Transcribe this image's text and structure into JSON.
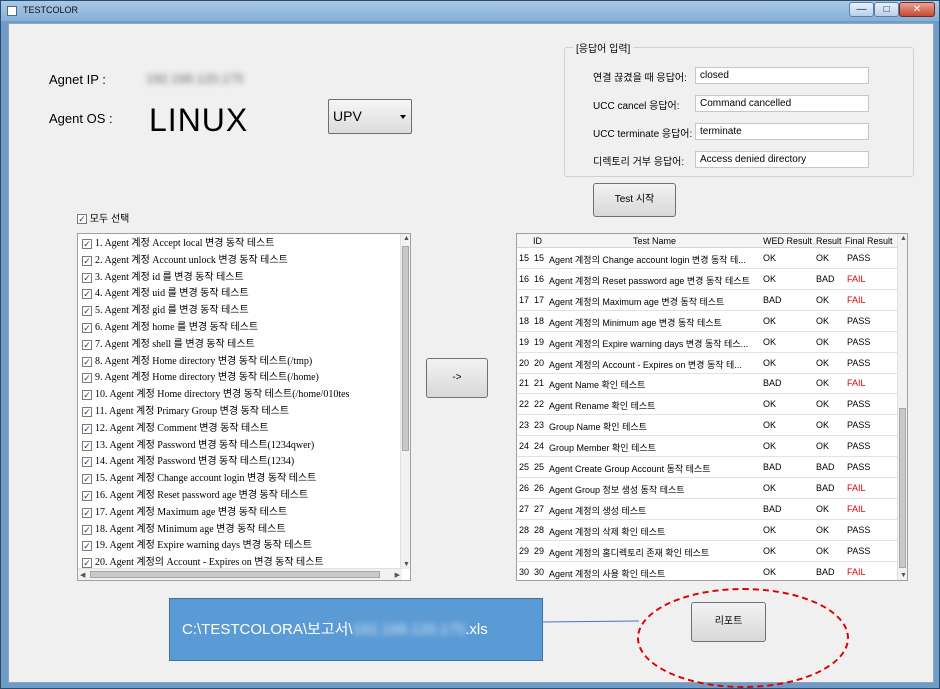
{
  "window": {
    "title": "TESTCOLOR",
    "min_glyph": "—",
    "max_glyph": "□",
    "close_glyph": "✕"
  },
  "agent": {
    "ip_label": "Agnet IP :",
    "ip_value": "192.168.120.175",
    "os_label": "Agent OS :",
    "os_value": "LINUX",
    "type_combo": "UPV"
  },
  "responses": {
    "legend": "[응답어 입력]",
    "rows": [
      {
        "label": "연결 끊겼을 때 응답어:",
        "value": "closed"
      },
      {
        "label": "UCC cancel 응답어:",
        "value": "Command cancelled"
      },
      {
        "label": "UCC terminate 응답어:",
        "value": "terminate"
      },
      {
        "label": "디렉토리 거부 응답어:",
        "value": "Access denied directory"
      }
    ]
  },
  "test_start_label": "Test 시작",
  "select_all_label": "모두 선택",
  "select_all_checked": true,
  "test_list": [
    "1. Agent 계정 Accept local 변경 동작 테스트",
    "2. Agent 계정 Account unlock 변경 동작 테스트",
    "3. Agent 계정 id 를 변경 동작 테스트",
    "4. Agent 계정 uid 를 변경 동작 테스트",
    "5. Agent 계정 gid 를 변경 동작 테스트",
    "6. Agent 계정 home 를 변경 동작 테스트",
    "7. Agent 계정 shell 를 변경 동작 테스트",
    "8. Agent 계정 Home directory 변경 동작 테스트(/tmp)",
    "9. Agent 계정 Home directory 변경 동작 테스트(/home)",
    "10. Agent 계정 Home directory 변경 동작 테스트(/home/010tes",
    "11. Agent 계정 Primary Group 변경 동작 테스트",
    "12. Agent 계정 Comment 변경 동작 테스트",
    "13. Agent 계정 Password 변경 동작 테스트(1234qwer)",
    "14. Agent 계정 Password 변경 동작 테스트(1234)",
    "15. Agent 계정 Change account login 변경 동작 테스트",
    "16. Agent 계정 Reset password age 변경 동작 테스트",
    "17. Agent 계정 Maximum age 변경 동작 테스트",
    "18. Agent 계정 Minimum age 변경 동작 테스트",
    "19. Agent 계정 Expire warning days 변경 동작 테스트",
    "20. Agent 계정의 Account - Expires on 변경 동작 테스트"
  ],
  "move_button_label": "->",
  "results": {
    "headers": [
      "ID",
      "Test Name",
      "WED Result",
      "Result",
      "Final Result"
    ],
    "rows": [
      {
        "n": "15",
        "id": "15",
        "name": "Agent 계정의 Change account login 변경 동작 테...",
        "wed": "OK",
        "result": "OK",
        "final": "PASS"
      },
      {
        "n": "16",
        "id": "16",
        "name": "Agent 계정의 Reset password age 변경 동작 테스트",
        "wed": "OK",
        "result": "BAD",
        "final": "FAIL"
      },
      {
        "n": "17",
        "id": "17",
        "name": "Agent 계정의 Maximum age 변경 동작 테스트",
        "wed": "BAD",
        "result": "OK",
        "final": "FAIL"
      },
      {
        "n": "18",
        "id": "18",
        "name": "Agent 계정의 Minimum age 변경 동작 테스트",
        "wed": "OK",
        "result": "OK",
        "final": "PASS"
      },
      {
        "n": "19",
        "id": "19",
        "name": "Agent 계정의 Expire warning days 변경 동작 테스...",
        "wed": "OK",
        "result": "OK",
        "final": "PASS"
      },
      {
        "n": "20",
        "id": "20",
        "name": "Agent 계정의 Account - Expires on 변경 동작 테...",
        "wed": "OK",
        "result": "OK",
        "final": "PASS"
      },
      {
        "n": "21",
        "id": "21",
        "name": "Agent Name 확인 테스트",
        "wed": "BAD",
        "result": "OK",
        "final": "FAIL"
      },
      {
        "n": "22",
        "id": "22",
        "name": "Agent Rename 확인 테스트",
        "wed": "OK",
        "result": "OK",
        "final": "PASS"
      },
      {
        "n": "23",
        "id": "23",
        "name": "Group Name 확인 테스트",
        "wed": "OK",
        "result": "OK",
        "final": "PASS"
      },
      {
        "n": "24",
        "id": "24",
        "name": "Group Member 확인 테스트",
        "wed": "OK",
        "result": "OK",
        "final": "PASS"
      },
      {
        "n": "25",
        "id": "25",
        "name": "Agent Create Group Account 동작 테스트",
        "wed": "BAD",
        "result": "BAD",
        "final": "PASS"
      },
      {
        "n": "26",
        "id": "26",
        "name": "Agent Group 정보 생성 동작 테스트",
        "wed": "OK",
        "result": "BAD",
        "final": "FAIL"
      },
      {
        "n": "27",
        "id": "27",
        "name": "Agent 계정의 생성 테스트",
        "wed": "BAD",
        "result": "OK",
        "final": "FAIL"
      },
      {
        "n": "28",
        "id": "28",
        "name": "Agent 계정의 삭제 확인 테스트",
        "wed": "OK",
        "result": "OK",
        "final": "PASS"
      },
      {
        "n": "29",
        "id": "29",
        "name": "Agent 계정의 홈디렉토리 존재 확인 테스트",
        "wed": "OK",
        "result": "OK",
        "final": "PASS"
      },
      {
        "n": "30",
        "id": "30",
        "name": "Agent 계정의 사용 확인 테스트",
        "wed": "OK",
        "result": "BAD",
        "final": "FAIL"
      }
    ]
  },
  "report_path": {
    "prefix": "C:\\TESTCOLORA\\보고서\\",
    "blurred": "192.168.120.175",
    "suffix": ".xls"
  },
  "report_button_label": "리포트",
  "colors": {
    "fail": "#e00000",
    "path_box": "#5b9bd5",
    "highlight_ellipse": "#e00000"
  }
}
